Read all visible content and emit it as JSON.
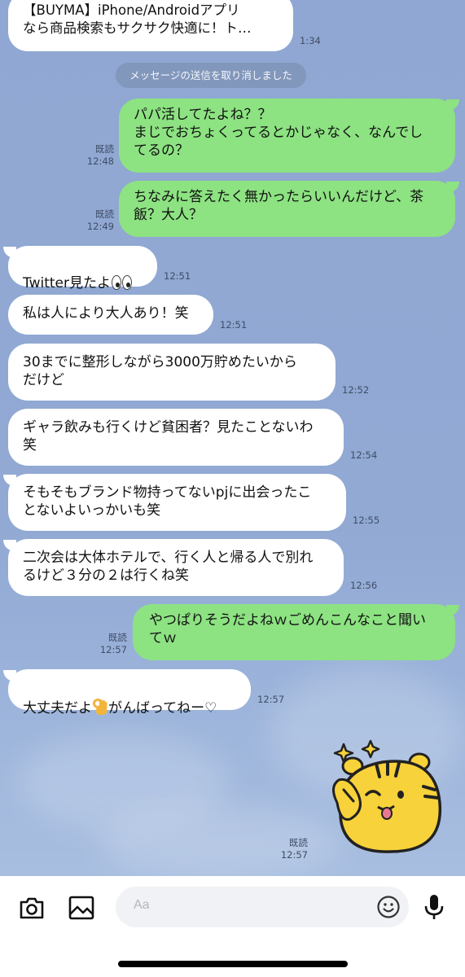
{
  "system_notice": "メッセージの送信を取り消しました",
  "messages": [
    {
      "id": "m0",
      "side": "in",
      "text": "【BUYMA】iPhone/Androidアプリ\nなら商品検索もサクサク快適に！ト…",
      "time": "1:34",
      "read": ""
    },
    {
      "id": "m1",
      "side": "out",
      "text": "パパ活してたよね？？\nまじでおちょくってるとかじゃなく、なんでし\nてるの？",
      "time": "12:48",
      "read": "既読"
    },
    {
      "id": "m2",
      "side": "out",
      "text": "ちなみに答えたく無かったらいいんだけど、茶\n飯？大人？",
      "time": "12:49",
      "read": "既読"
    },
    {
      "id": "m3",
      "side": "in",
      "text": "Twitter見たよ",
      "emoji": "eyes-emoji",
      "time": "12:51"
    },
    {
      "id": "m4",
      "side": "in",
      "text": "私は人により大人あり！笑",
      "time": "12:51"
    },
    {
      "id": "m5",
      "side": "in",
      "text": "30までに整形しながら3000万貯めたいから\nだけど",
      "time": "12:52"
    },
    {
      "id": "m6",
      "side": "in",
      "text": "ギャラ飲みも行くけど貧困者？見たことないわ\n笑",
      "time": "12:54"
    },
    {
      "id": "m7",
      "side": "in",
      "text": "そもそもブランド物持ってないpjに出会ったこ\nとないよいっかいも笑",
      "time": "12:55"
    },
    {
      "id": "m8",
      "side": "in",
      "text": "二次会は大体ホテルで、行く人と帰る人で別れ\nるけど３分の２は行くね笑",
      "time": "12:56"
    },
    {
      "id": "m9",
      "side": "out",
      "text": "やつぱりそうだよねｗごめんこんなこと聞い\nてｗ",
      "time": "12:57",
      "read": "既読"
    },
    {
      "id": "m10",
      "side": "in",
      "text_a": "大丈夫だよ",
      "emoji": "ok-hand-emoji",
      "text_b": "がんばってねー♡",
      "time": "12:57"
    },
    {
      "id": "m11",
      "side": "out",
      "type": "sticker",
      "sticker": "tiger-sticker",
      "time": "12:57",
      "read": "既読"
    }
  ],
  "input": {
    "placeholder": "Aa"
  },
  "icons": [
    "camera-icon",
    "image-icon",
    "emoji-icon",
    "microphone-icon"
  ],
  "colors": {
    "outgoing_bubble": "#8de282",
    "incoming_bubble": "#ffffff",
    "chat_background": "#8fa7d2"
  }
}
